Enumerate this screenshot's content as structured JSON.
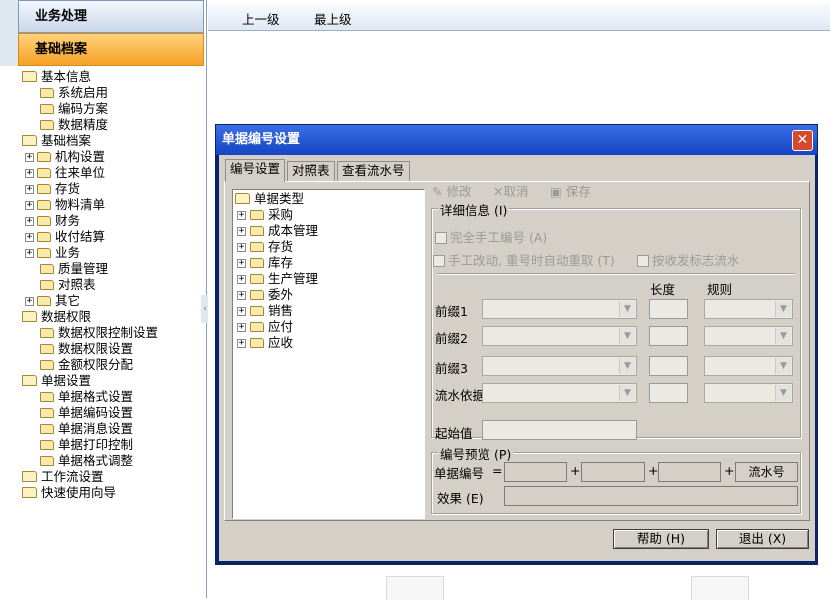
{
  "left": {
    "header_business": "业务处理",
    "header_base": "基础档案",
    "tree": [
      {
        "label": "基本信息",
        "level": 0,
        "expander": ""
      },
      {
        "label": "系统启用",
        "level": 1,
        "expander": ""
      },
      {
        "label": "编码方案",
        "level": 1,
        "expander": ""
      },
      {
        "label": "数据精度",
        "level": 1,
        "expander": ""
      },
      {
        "label": "基础档案",
        "level": 0,
        "expander": ""
      },
      {
        "label": "机构设置",
        "level": 1,
        "expander": "+"
      },
      {
        "label": "往来单位",
        "level": 1,
        "expander": "+"
      },
      {
        "label": "存货",
        "level": 1,
        "expander": "+"
      },
      {
        "label": "物料清单",
        "level": 1,
        "expander": "+"
      },
      {
        "label": "财务",
        "level": 1,
        "expander": "+"
      },
      {
        "label": "收付结算",
        "level": 1,
        "expander": "+"
      },
      {
        "label": "业务",
        "level": 1,
        "expander": "+"
      },
      {
        "label": "质量管理",
        "level": 1,
        "expander": ""
      },
      {
        "label": "对照表",
        "level": 1,
        "expander": ""
      },
      {
        "label": "其它",
        "level": 1,
        "expander": "+"
      },
      {
        "label": "数据权限",
        "level": 0,
        "expander": ""
      },
      {
        "label": "数据权限控制设置",
        "level": 1,
        "expander": ""
      },
      {
        "label": "数据权限设置",
        "level": 1,
        "expander": ""
      },
      {
        "label": "金额权限分配",
        "level": 1,
        "expander": ""
      },
      {
        "label": "单据设置",
        "level": 0,
        "expander": ""
      },
      {
        "label": "单据格式设置",
        "level": 1,
        "expander": ""
      },
      {
        "label": "单据编码设置",
        "level": 1,
        "expander": ""
      },
      {
        "label": "单据消息设置",
        "level": 1,
        "expander": ""
      },
      {
        "label": "单据打印控制",
        "level": 1,
        "expander": ""
      },
      {
        "label": "单据格式调整",
        "level": 1,
        "expander": ""
      },
      {
        "label": "工作流设置",
        "level": 0,
        "expander": ""
      },
      {
        "label": "快速使用向导",
        "level": 0,
        "expander": ""
      }
    ]
  },
  "toolbar": {
    "up_level": "上一级",
    "top_level": "最上级"
  },
  "dialog": {
    "title": "单据编号设置",
    "close": "✕",
    "tabs": [
      "编号设置",
      "对照表",
      "查看流水号"
    ],
    "type_tree": {
      "root": "单据类型",
      "items": [
        "采购",
        "成本管理",
        "存货",
        "库存",
        "生产管理",
        "委外",
        "销售",
        "应付",
        "应收"
      ]
    },
    "actions": {
      "modify": "修改",
      "cancel": "取消",
      "save": "保存"
    },
    "detail": {
      "title": "详细信息 (I)",
      "full_manual": "完全手工编号 (A)",
      "manual_change": "手工改动, 重号时自动重取 (T)",
      "by_flag": "按收发标志流水",
      "col_length": "长度",
      "col_rule": "规则",
      "rows": [
        "前缀1",
        "前缀2",
        "前缀3",
        "流水依据"
      ],
      "start_value": "起始值"
    },
    "preview": {
      "title": "编号预览 (P)",
      "doc_no_label": "单据编号",
      "equals": "=",
      "plus": "+",
      "serial": "流水号",
      "effect_label": "效果 (E)"
    },
    "help_button": "帮助 (H)",
    "exit_button": "退出 (X)"
  }
}
